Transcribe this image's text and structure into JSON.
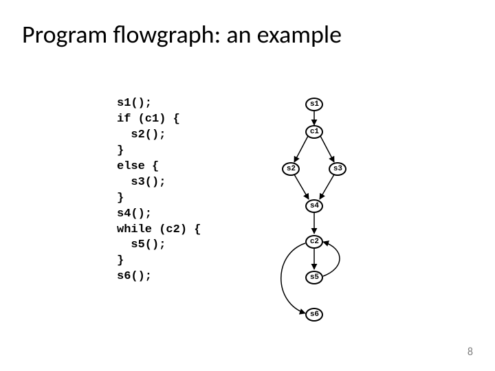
{
  "title": "Program flowgraph: an example",
  "page_number": "8",
  "code": "s1();\nif (c1) {\n  s2();\n}\nelse {\n  s3();\n}\ns4();\nwhile (c2) {\n  s5();\n}\ns6();",
  "nodes": {
    "s1": "s1",
    "c1": "c1",
    "s2": "s2",
    "s3": "s3",
    "s4": "s4",
    "c2": "c2",
    "s5": "s5",
    "s6": "s6"
  }
}
